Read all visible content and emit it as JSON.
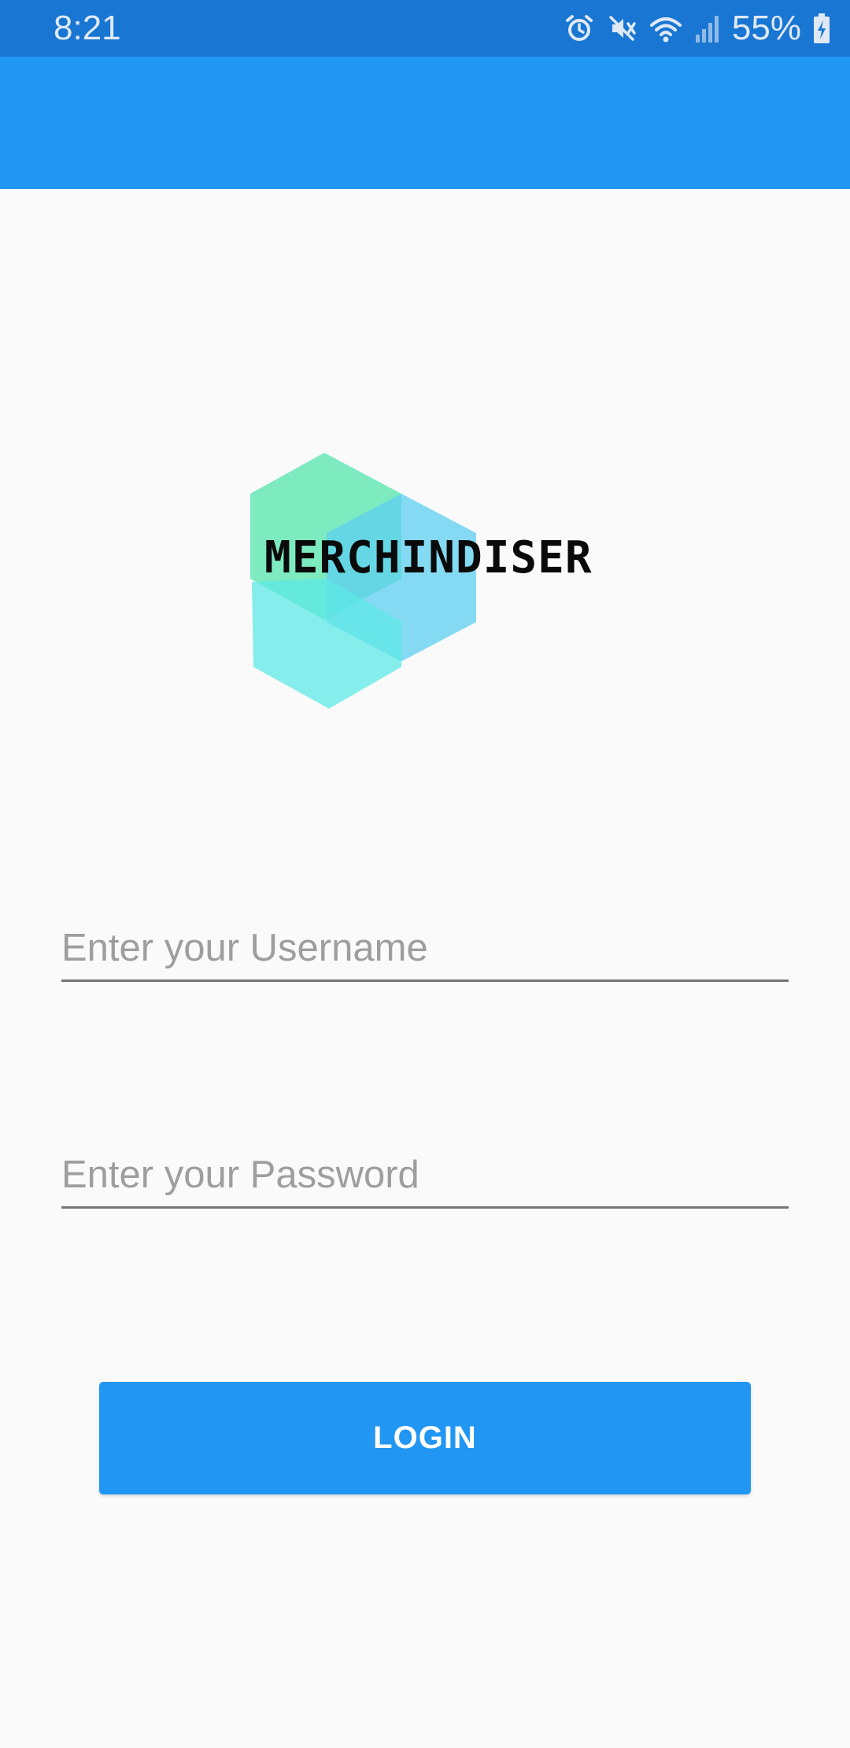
{
  "status_bar": {
    "time": "8:21",
    "battery_percent": "55%",
    "icons": [
      "alarm-icon",
      "mute-icon",
      "wifi-icon",
      "signal-icon",
      "battery-charging-icon"
    ]
  },
  "app_bar": {
    "color": "#2196f3"
  },
  "logo": {
    "text": "MERCHINDISER"
  },
  "form": {
    "username_placeholder": "Enter your Username",
    "username_value": "",
    "password_placeholder": "Enter your Password",
    "password_value": "",
    "login_label": "LOGIN"
  },
  "colors": {
    "status_bar": "#1976d2",
    "primary": "#2196f3",
    "background": "#fafafa"
  }
}
